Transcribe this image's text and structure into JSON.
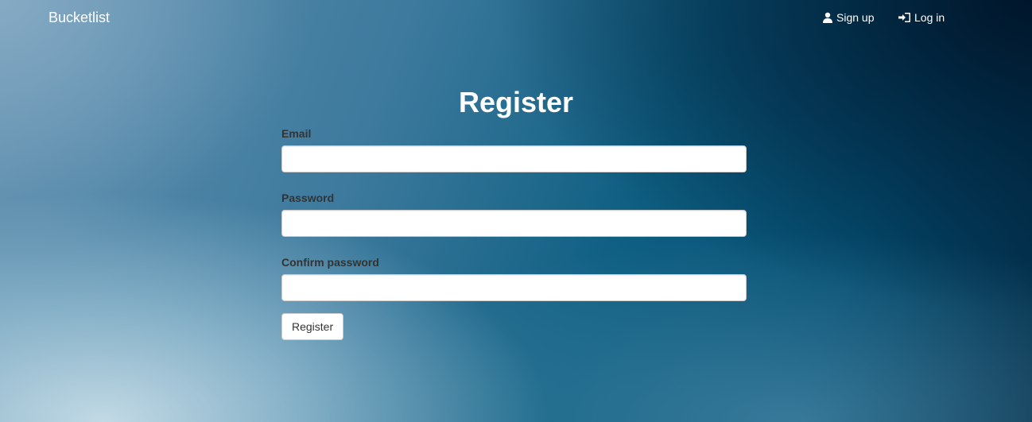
{
  "navbar": {
    "brand": "Bucketlist",
    "signup": {
      "label": "Sign up",
      "icon": "user-icon"
    },
    "login": {
      "label": "Log in",
      "icon": "log-in-icon"
    }
  },
  "form": {
    "title": "Register",
    "fields": [
      {
        "label": "Email",
        "value": "",
        "placeholder": ""
      },
      {
        "label": "Password",
        "value": "",
        "placeholder": ""
      },
      {
        "label": "Confirm password",
        "value": "",
        "placeholder": ""
      }
    ],
    "submit_label": "Register"
  },
  "colors": {
    "text_light": "#ffffff",
    "label_text": "#333333",
    "background_dark": "#022b45",
    "background_mid": "#0e5f82",
    "background_light": "#c8dee8"
  }
}
